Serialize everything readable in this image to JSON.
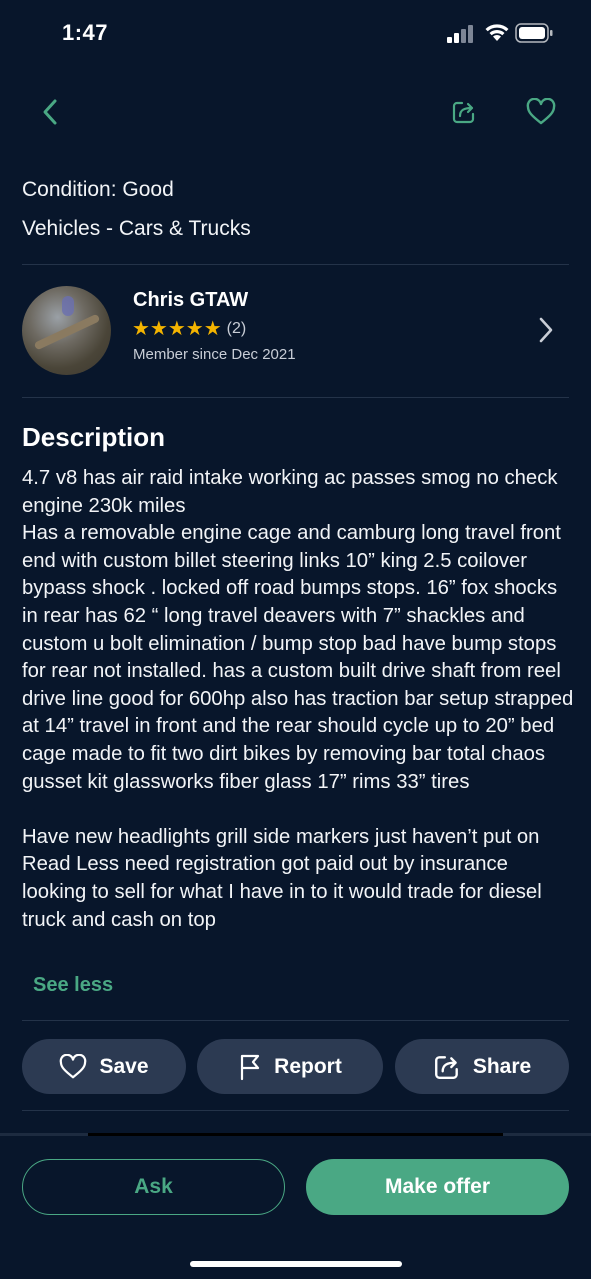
{
  "status_bar": {
    "time": "1:47"
  },
  "listing": {
    "condition": "Condition: Good",
    "category": "Vehicles - Cars & Trucks"
  },
  "seller": {
    "name": "Chris GTAW",
    "stars": "★★★★★",
    "rating_count": "(2)",
    "member_since": "Member since Dec 2021"
  },
  "description": {
    "title": "Description",
    "body": "4.7 v8 has air raid intake working ac passes smog no check engine  230k miles\nHas a removable engine cage and camburg long travel front end with custom billet steering links 10” king 2.5 coilover bypass shock . locked off road bumps stops. 16” fox shocks in rear has 62 “ long travel deavers with 7” shackles and custom u bolt elimination / bump stop bad have bump stops for rear not installed. has a custom built drive shaft from reel drive line good for 600hp also has traction bar setup strapped at 14” travel in front and the rear should cycle up to 20” bed cage made to fit two dirt bikes by removing bar total chaos gusset kit glassworks fiber glass 17” rims 33” tires\n\nHave new headlights grill side markers just haven’t put on Read Less need registration got paid out by insurance looking to sell for what I have in to it would trade for diesel truck and cash on top",
    "toggle_label": "See less"
  },
  "actions": {
    "save_label": "Save",
    "report_label": "Report",
    "share_label": "Share"
  },
  "footer": {
    "ask_label": "Ask",
    "offer_label": "Make offer"
  },
  "colors": {
    "background": "#08162b",
    "accent": "#4aa884",
    "pill": "#2c3a52",
    "star": "#f4b400"
  }
}
